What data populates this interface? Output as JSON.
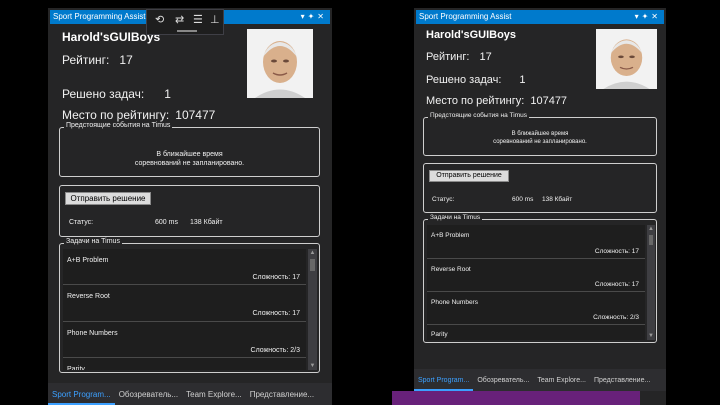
{
  "window_title": "Sport Programming Assist",
  "team_name": "Harold'sGUIBoys",
  "rating_label": "Рейтинг:",
  "rating_value": "17",
  "solved_label": "Решено задач:",
  "solved_value": "1",
  "place_label": "Место по рейтингу:",
  "place_value": "107477",
  "events": {
    "title": "Предстоящие события на Timus",
    "message_line1": "В ближайшее время",
    "message_line2": "соревнований не запланировано."
  },
  "submit": {
    "button_label": "Отправить решение",
    "status_label": "Статус:",
    "time": "600 ms",
    "memory": "138 Кбайт"
  },
  "problems": {
    "title": "Задачи на Timus",
    "items": [
      {
        "name": "A+B Problem",
        "difficulty": "Сложность: 17"
      },
      {
        "name": "Reverse Root",
        "difficulty": "Сложность: 17"
      },
      {
        "name": "Phone Numbers",
        "difficulty": "Сложность: 2/3"
      },
      {
        "name": "Parity",
        "difficulty": ""
      }
    ]
  },
  "tabs": [
    "Sport Program...",
    "Обозреватель...",
    "Team Explore...",
    "Представление..."
  ],
  "tabs_right": [
    "Sport Program...",
    "Обозреватель...",
    "Team Explore...",
    "Представление..."
  ],
  "colors": {
    "accent": "#007acc",
    "panel": "#252526",
    "list": "#1e1e1e",
    "tab_active": "#3ca0ff",
    "bottom_bar": "#68217a"
  }
}
